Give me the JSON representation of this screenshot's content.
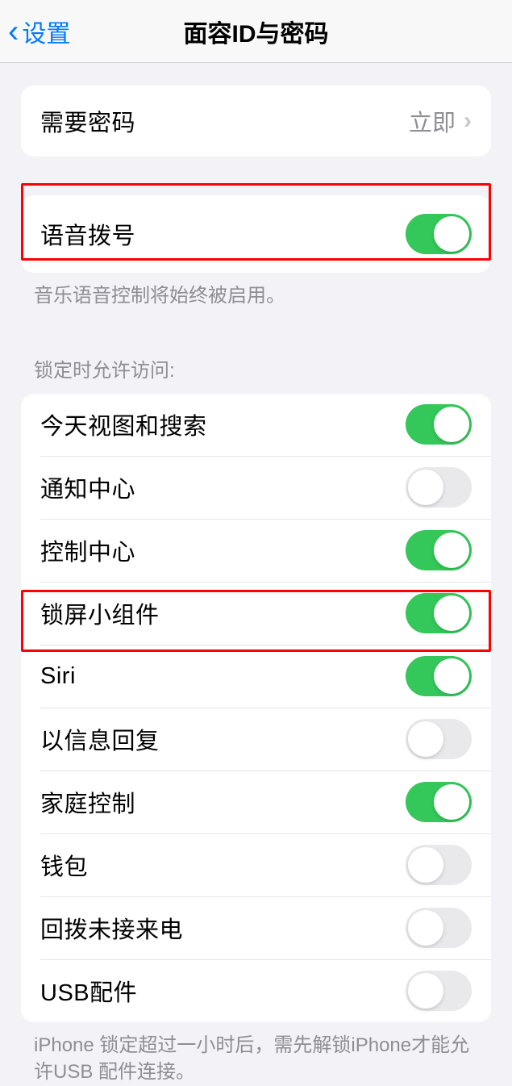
{
  "nav": {
    "back_label": "设置",
    "title": "面容ID与密码"
  },
  "passcode_row": {
    "label": "需要密码",
    "value": "立即"
  },
  "voice_dial": {
    "label": "语音拨号",
    "footer": "音乐语音控制将始终被启用。"
  },
  "lock_section": {
    "header": "锁定时允许访问:",
    "items": [
      {
        "label": "今天视图和搜索",
        "on": true
      },
      {
        "label": "通知中心",
        "on": false
      },
      {
        "label": "控制中心",
        "on": true
      },
      {
        "label": "锁屏小组件",
        "on": true
      },
      {
        "label": "Siri",
        "on": true
      },
      {
        "label": "以信息回复",
        "on": false
      },
      {
        "label": "家庭控制",
        "on": true
      },
      {
        "label": "钱包",
        "on": false
      },
      {
        "label": "回拨未接来电",
        "on": false
      },
      {
        "label": "USB配件",
        "on": false
      }
    ],
    "footer": "iPhone 锁定超过一小时后，需先解锁iPhone才能允许USB 配件连接。"
  }
}
